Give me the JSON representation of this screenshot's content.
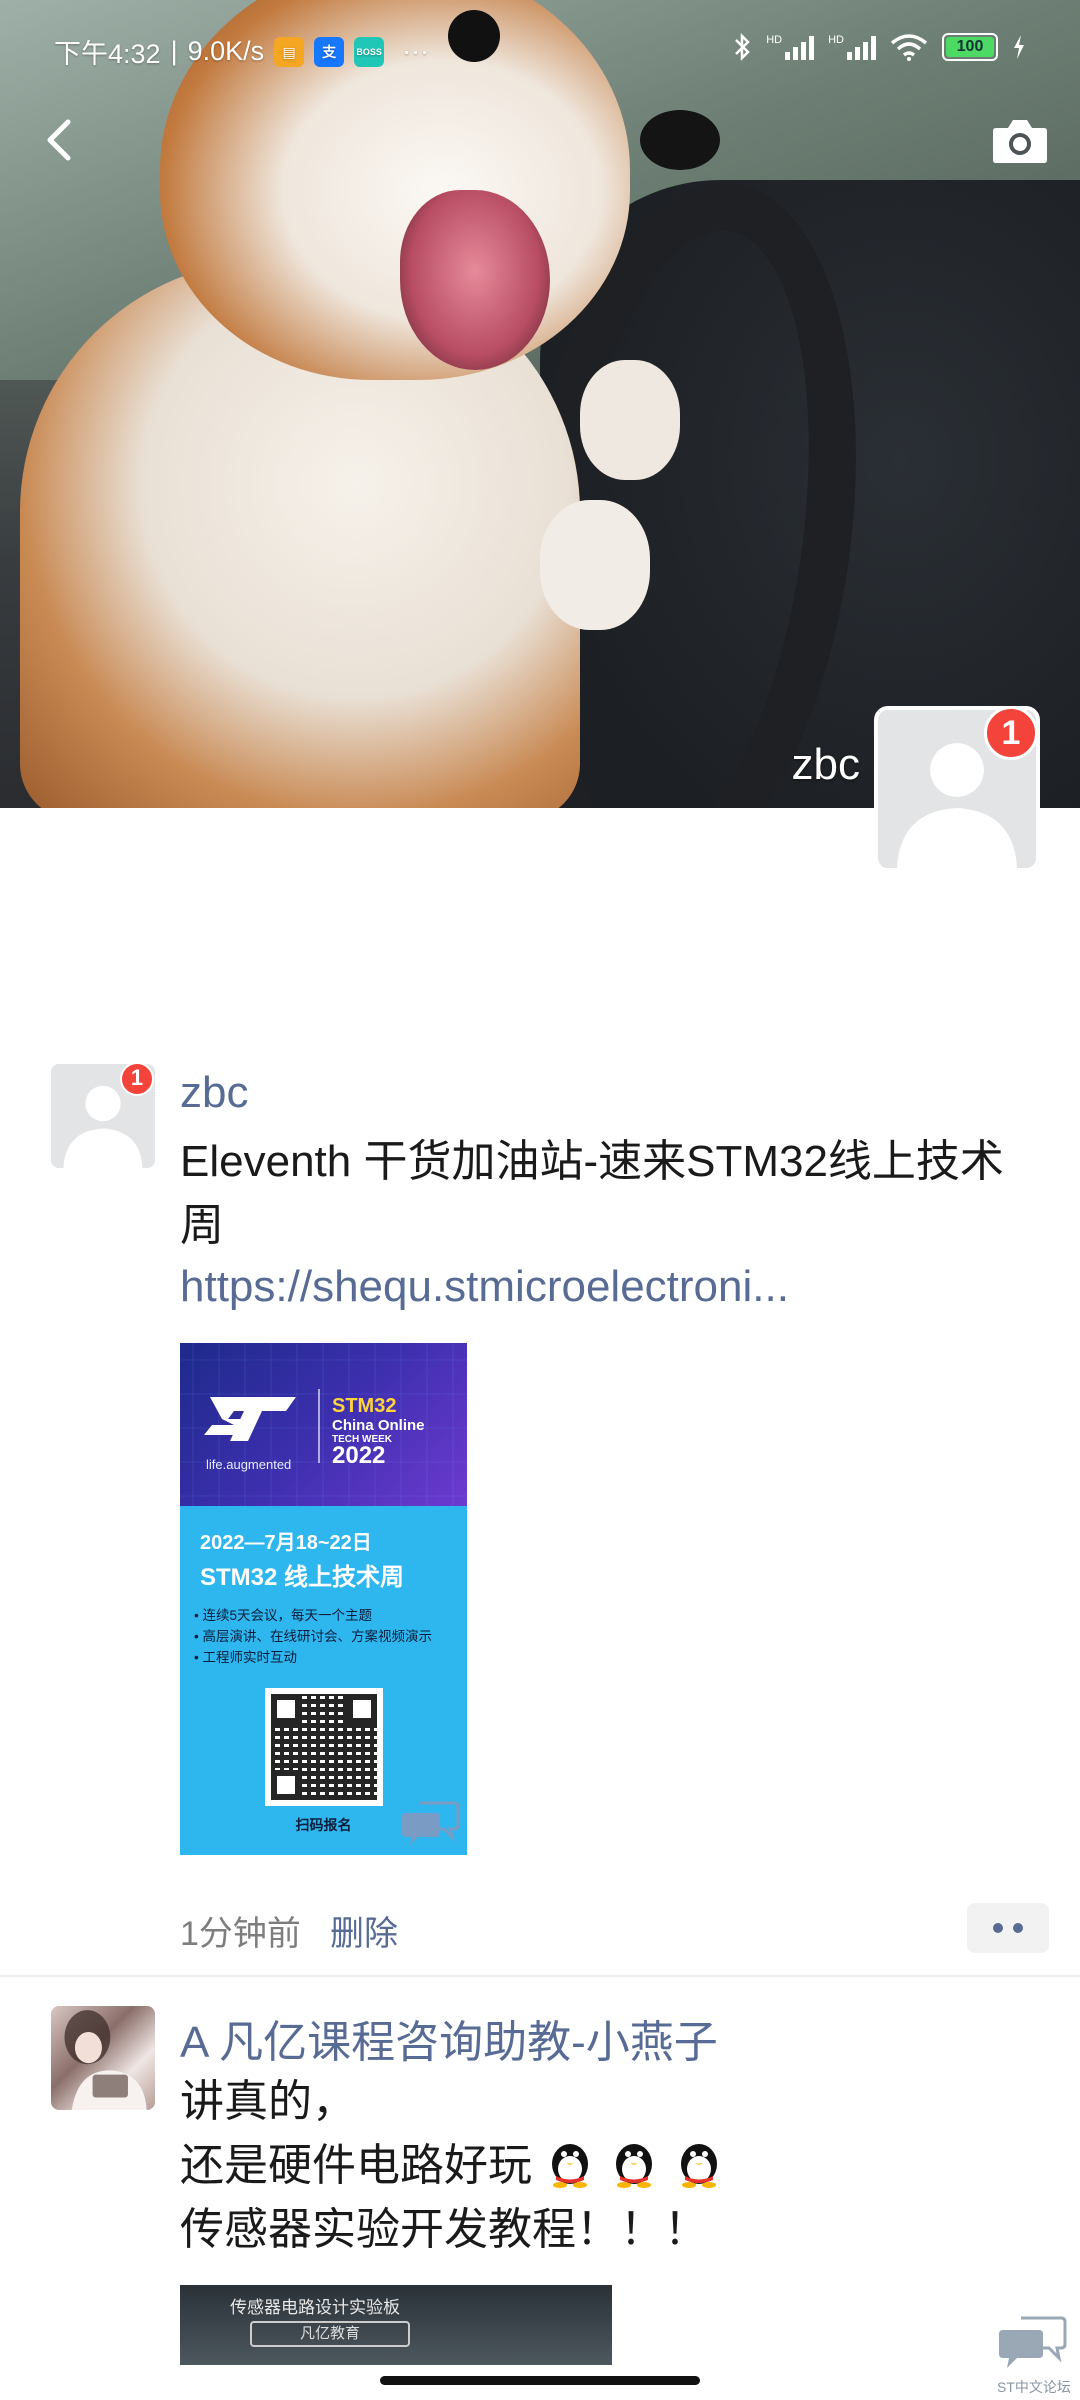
{
  "status_bar": {
    "time": "下午4:32",
    "net_speed": "9.0K/s",
    "app_icon_2": "支",
    "app_icon_3": "BOSS",
    "more": "···",
    "signal_1": "HD",
    "signal_2": "HD",
    "battery": "100"
  },
  "nav": {
    "back_icon": "chevron-left-icon",
    "camera_icon": "camera-icon"
  },
  "cover": {
    "username": "zbc",
    "badge": "1"
  },
  "posts": [
    {
      "author": "zbc",
      "badge": "1",
      "text": "Eleventh  干货加油站-速来STM32线上技术周",
      "link": "https://shequ.stmicroelectroni...",
      "poster": {
        "tagline": "life.augmented",
        "stm": "STM32",
        "china_online": "China Online",
        "tech_week": "TECH WEEK",
        "year": "2022",
        "date": "2022—7月18~22日",
        "title": "STM32 线上技术周",
        "bullets": [
          "• 连续5天会议，每天一个主题",
          "• 高层演讲、在线研讨会、方案视频演示",
          "• 工程师实时互动"
        ],
        "scan": "扫码报名"
      },
      "time": "1分钟前",
      "delete": "删除"
    },
    {
      "author": "A  凡亿课程咨询助教-小燕子",
      "lines": [
        "讲真的，",
        "还是硬件电路好玩",
        "传感器实验开发教程！！！"
      ],
      "image": {
        "board_label": "传感器电路设计实验板",
        "board_brand": "凡亿教育"
      }
    }
  ],
  "watermark": "ST中文论坛"
}
